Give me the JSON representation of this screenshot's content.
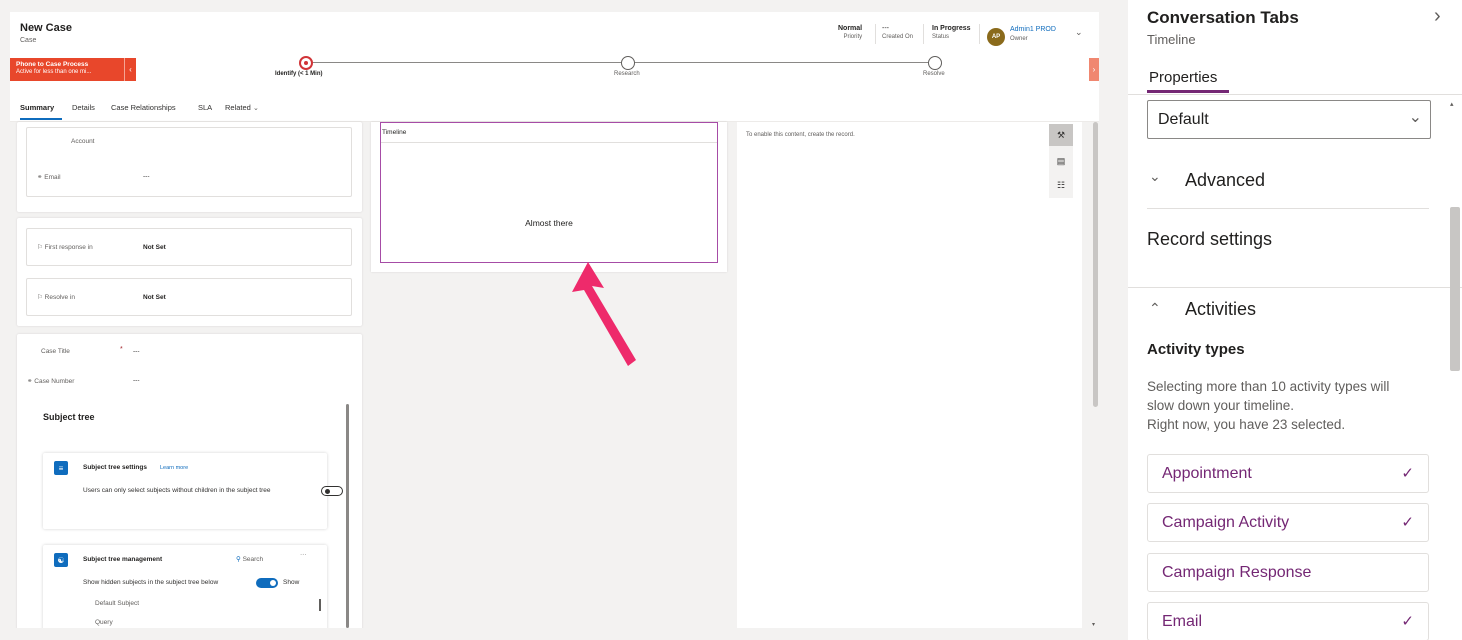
{
  "record": {
    "title": "New Case",
    "entity": "Case",
    "priority_value": "Normal",
    "priority_label": "Priority",
    "created_value": "---",
    "created_label": "Created On",
    "status_value": "In Progress",
    "status_label": "Status",
    "owner_initials": "AP",
    "owner_name": "Admin1 PROD",
    "owner_label": "Owner"
  },
  "bpf": {
    "process_name": "Phone to Case Process",
    "process_duration": "Active for less than one mi...",
    "stages": [
      {
        "label": "Identify  (< 1 Min)"
      },
      {
        "label": "Research"
      },
      {
        "label": "Resolve"
      }
    ]
  },
  "tabs": [
    "Summary",
    "Details",
    "Case Relationships",
    "SLA",
    "Related"
  ],
  "summary": {
    "account_label": "Account",
    "email_label": "Email",
    "email_value": "---",
    "first_response_label": "First response in",
    "first_response_value": "Not Set",
    "resolve_in_label": "Resolve in",
    "resolve_in_value": "Not Set",
    "case_title_label": "Case Title",
    "case_title_value": "---",
    "case_number_label": "Case Number",
    "case_number_value": "---"
  },
  "subject_tree": {
    "title": "Subject tree",
    "settings_title": "Subject tree settings",
    "settings_link": "Learn more",
    "settings_text": "Users can only select subjects without children in the subject tree",
    "mgmt_title": "Subject tree management",
    "mgmt_search": "Search",
    "mgmt_more": "···",
    "mgmt_show_text": "Show hidden subjects in the subject tree below",
    "mgmt_show_label": "Show",
    "items": [
      "Default Subject",
      "Query"
    ]
  },
  "timeline": {
    "title": "Timeline",
    "message": "Almost there"
  },
  "right_card": {
    "message": "To enable this content, create the record."
  },
  "pane": {
    "title": "Conversation Tabs",
    "subtitle": "Timeline",
    "tab": "Properties",
    "select_value": "Default",
    "advanced": "Advanced",
    "record_settings": "Record settings",
    "activities": "Activities",
    "activity_types": "Activity types",
    "desc_line1": "Selecting more than 10 activity types will",
    "desc_line2": "slow down your timeline.",
    "desc_line3": "Right now, you have 23 selected.",
    "items": [
      {
        "label": "Appointment",
        "checked": true
      },
      {
        "label": "Campaign Activity",
        "checked": true
      },
      {
        "label": "Campaign Response",
        "checked": false
      },
      {
        "label": "Email",
        "checked": true
      }
    ]
  },
  "colors": {
    "accent_purple": "#742774",
    "bpf_red": "#e8472b",
    "link_blue": "#0f6cbd",
    "annotation_pink": "#ee2a6b"
  }
}
